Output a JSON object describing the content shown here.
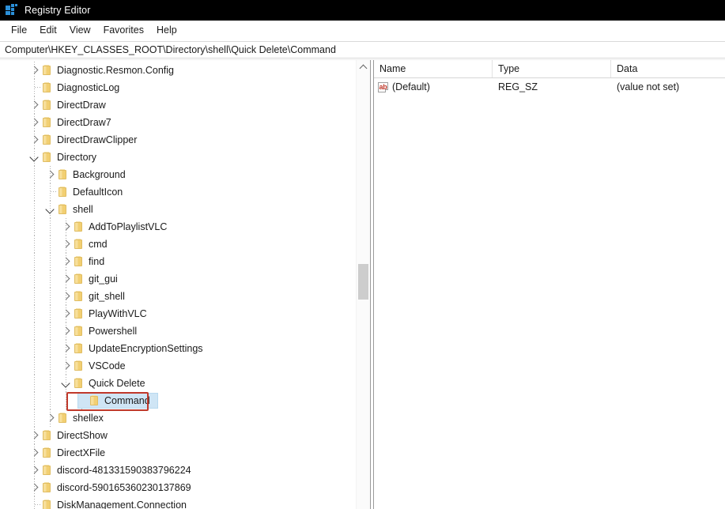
{
  "window": {
    "title": "Registry Editor",
    "icon": "registry-editor-icon",
    "titlebar_color": "#000000"
  },
  "menubar": {
    "items": [
      {
        "label": "File"
      },
      {
        "label": "Edit"
      },
      {
        "label": "View"
      },
      {
        "label": "Favorites"
      },
      {
        "label": "Help"
      }
    ]
  },
  "addressbar": {
    "path": "Computer\\HKEY_CLASSES_ROOT\\Directory\\shell\\Quick Delete\\Command"
  },
  "tree": {
    "selection_color": "#cfe5f5",
    "annotation_color": "#c0392b",
    "scrollbar": {
      "thumb_color": "#cdcdcd",
      "up_arrow": "chevron-up-icon"
    },
    "nodes": [
      {
        "label": "Diagnostic.Resmon.Config",
        "depth": 1,
        "state": "collapsed"
      },
      {
        "label": "DiagnosticLog",
        "depth": 1,
        "state": "leaf"
      },
      {
        "label": "DirectDraw",
        "depth": 1,
        "state": "collapsed"
      },
      {
        "label": "DirectDraw7",
        "depth": 1,
        "state": "collapsed"
      },
      {
        "label": "DirectDrawClipper",
        "depth": 1,
        "state": "collapsed"
      },
      {
        "label": "Directory",
        "depth": 1,
        "state": "expanded"
      },
      {
        "label": "Background",
        "depth": 2,
        "state": "collapsed"
      },
      {
        "label": "DefaultIcon",
        "depth": 2,
        "state": "leaf"
      },
      {
        "label": "shell",
        "depth": 2,
        "state": "expanded"
      },
      {
        "label": "AddToPlaylistVLC",
        "depth": 3,
        "state": "collapsed"
      },
      {
        "label": "cmd",
        "depth": 3,
        "state": "collapsed"
      },
      {
        "label": "find",
        "depth": 3,
        "state": "collapsed"
      },
      {
        "label": "git_gui",
        "depth": 3,
        "state": "collapsed"
      },
      {
        "label": "git_shell",
        "depth": 3,
        "state": "collapsed"
      },
      {
        "label": "PlayWithVLC",
        "depth": 3,
        "state": "collapsed"
      },
      {
        "label": "Powershell",
        "depth": 3,
        "state": "collapsed"
      },
      {
        "label": "UpdateEncryptionSettings",
        "depth": 3,
        "state": "collapsed"
      },
      {
        "label": "VSCode",
        "depth": 3,
        "state": "collapsed"
      },
      {
        "label": "Quick Delete",
        "depth": 3,
        "state": "expanded"
      },
      {
        "label": "Command",
        "depth": 4,
        "state": "leaf",
        "selected": true,
        "annotated": true
      },
      {
        "label": "shellex",
        "depth": 2,
        "state": "collapsed"
      },
      {
        "label": "DirectShow",
        "depth": 1,
        "state": "collapsed"
      },
      {
        "label": "DirectXFile",
        "depth": 1,
        "state": "collapsed"
      },
      {
        "label": "discord-481331590383796224",
        "depth": 1,
        "state": "collapsed"
      },
      {
        "label": "discord-590165360230137869",
        "depth": 1,
        "state": "collapsed"
      },
      {
        "label": "DiskManagement.Connection",
        "depth": 1,
        "state": "leaf"
      }
    ]
  },
  "list": {
    "columns": [
      {
        "label": "Name"
      },
      {
        "label": "Type"
      },
      {
        "label": "Data"
      }
    ],
    "rows": [
      {
        "icon": "string-value-icon",
        "icon_text": "ab",
        "name": "(Default)",
        "type": "REG_SZ",
        "data": "(value not set)"
      }
    ]
  }
}
